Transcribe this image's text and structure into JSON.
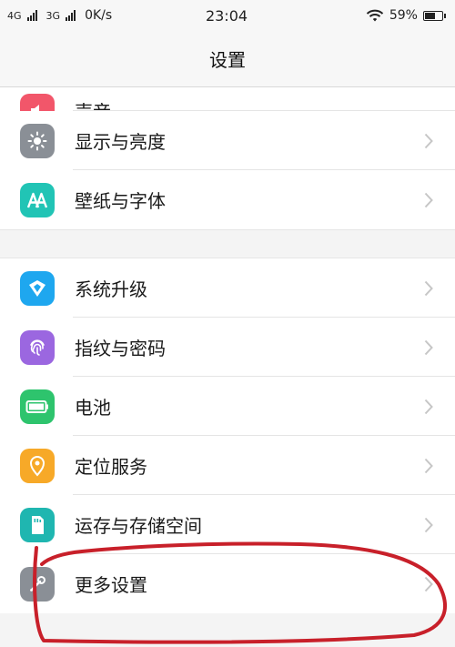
{
  "status_bar": {
    "network_1": "4G",
    "network_2": "3G",
    "speed": "0K/s",
    "time": "23:04",
    "battery": "59%"
  },
  "header": {
    "title": "设置"
  },
  "sections": [
    {
      "items": [
        {
          "label": "声音",
          "icon": "sound-icon",
          "color": "#f2566a"
        },
        {
          "label": "显示与亮度",
          "icon": "brightness-icon",
          "color": "#8a8f96"
        },
        {
          "label": "壁纸与字体",
          "icon": "wallpaper-font-icon",
          "color": "#21c4b5"
        }
      ]
    },
    {
      "items": [
        {
          "label": "系统升级",
          "icon": "system-update-icon",
          "color": "#1ea7ef"
        },
        {
          "label": "指纹与密码",
          "icon": "fingerprint-icon",
          "color": "#9b67e0"
        },
        {
          "label": "电池",
          "icon": "battery-icon",
          "color": "#2ec46d"
        },
        {
          "label": "定位服务",
          "icon": "location-icon",
          "color": "#f7a928"
        },
        {
          "label": "运存与存储空间",
          "icon": "storage-icon",
          "color": "#1fb6b0"
        },
        {
          "label": "更多设置",
          "icon": "more-settings-icon",
          "color": "#8a8f96"
        }
      ]
    }
  ],
  "annotation_color": "#c8202a"
}
